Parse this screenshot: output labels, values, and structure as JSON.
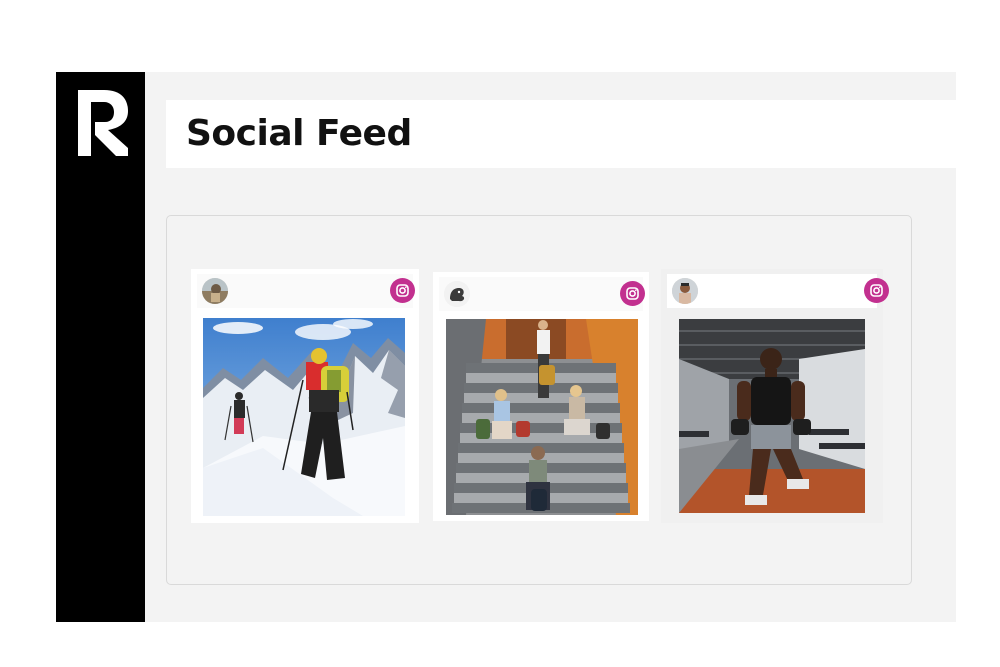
{
  "header": {
    "title": "Social Feed"
  },
  "brand": {
    "logo_icon": "brand-logo-icon",
    "sidebar_color": "#000000"
  },
  "feed": {
    "accent_color": "#c2308f",
    "source_icon": "instagram-icon",
    "posts": [
      {
        "avatar": "user-avatar",
        "image": "skiers-climbing-snowy-mountain-photo"
      },
      {
        "avatar": "user-avatar",
        "image": "people-sitting-on-stairs-photo"
      },
      {
        "avatar": "user-avatar",
        "image": "man-lunging-with-dumbbells-in-gym-photo"
      }
    ]
  }
}
